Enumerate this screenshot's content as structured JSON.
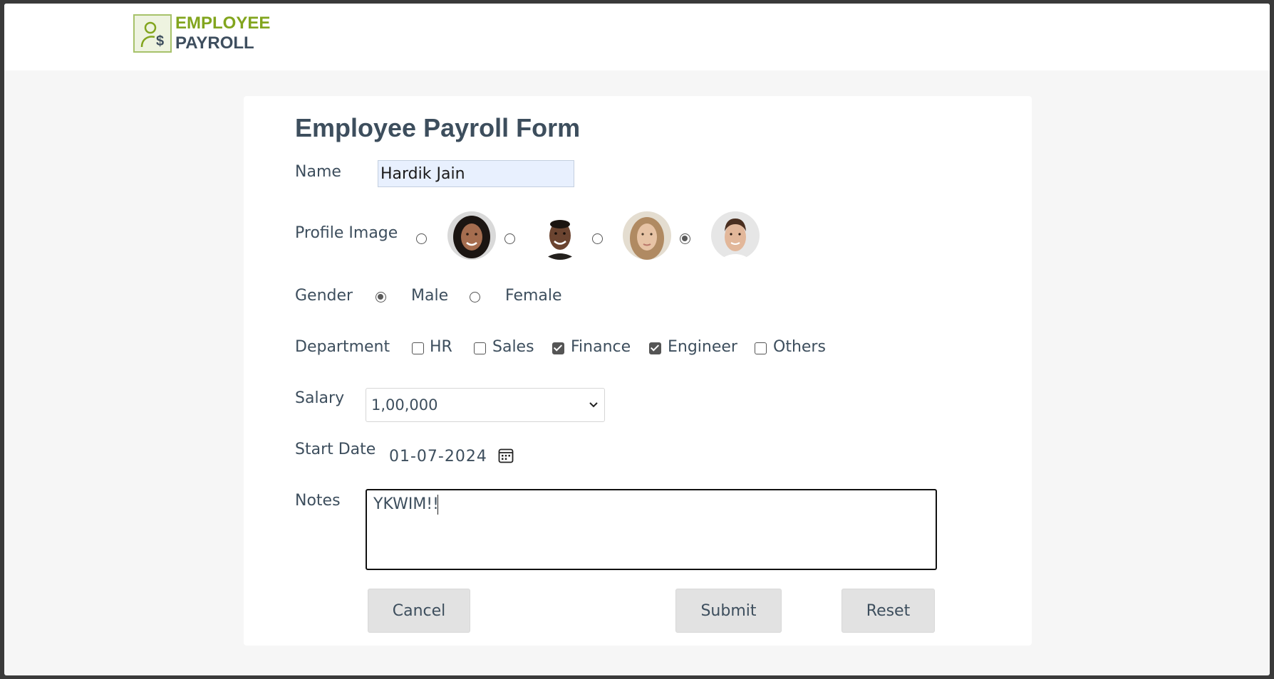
{
  "header": {
    "logo_line1": "EMPLOYEE",
    "logo_line2": "PAYROLL",
    "logo_icon": "employee-dollar-icon",
    "logo_color_primary": "#82a51e",
    "logo_color_secondary": "#3e4e5e"
  },
  "form": {
    "title": "Employee Payroll Form",
    "name": {
      "label": "Name",
      "value": "Hardik Jain"
    },
    "profile_image": {
      "label": "Profile Image",
      "options": [
        {
          "name": "female-avatar-1",
          "selected": false
        },
        {
          "name": "male-avatar-1",
          "selected": false
        },
        {
          "name": "female-avatar-2",
          "selected": false
        },
        {
          "name": "male-avatar-2",
          "selected": true
        }
      ]
    },
    "gender": {
      "label": "Gender",
      "options": [
        {
          "label": "Male",
          "selected": true
        },
        {
          "label": "Female",
          "selected": false
        }
      ]
    },
    "department": {
      "label": "Department",
      "options": [
        {
          "label": "HR",
          "checked": false
        },
        {
          "label": "Sales",
          "checked": false
        },
        {
          "label": "Finance",
          "checked": true
        },
        {
          "label": "Engineer",
          "checked": true
        },
        {
          "label": "Others",
          "checked": false
        }
      ]
    },
    "salary": {
      "label": "Salary",
      "selected": "1,00,000"
    },
    "start_date": {
      "label": "Start Date",
      "value": "01-07-2024",
      "icon": "calendar-icon"
    },
    "notes": {
      "label": "Notes",
      "value": "YKWIM!!"
    },
    "buttons": {
      "cancel": "Cancel",
      "submit": "Submit",
      "reset": "Reset"
    }
  },
  "colors": {
    "text": "#3d4e5d",
    "button_bg": "#e2e2e2",
    "input_autofill_bg": "#e8f0fe",
    "page_bg": "#f6f6f6"
  }
}
